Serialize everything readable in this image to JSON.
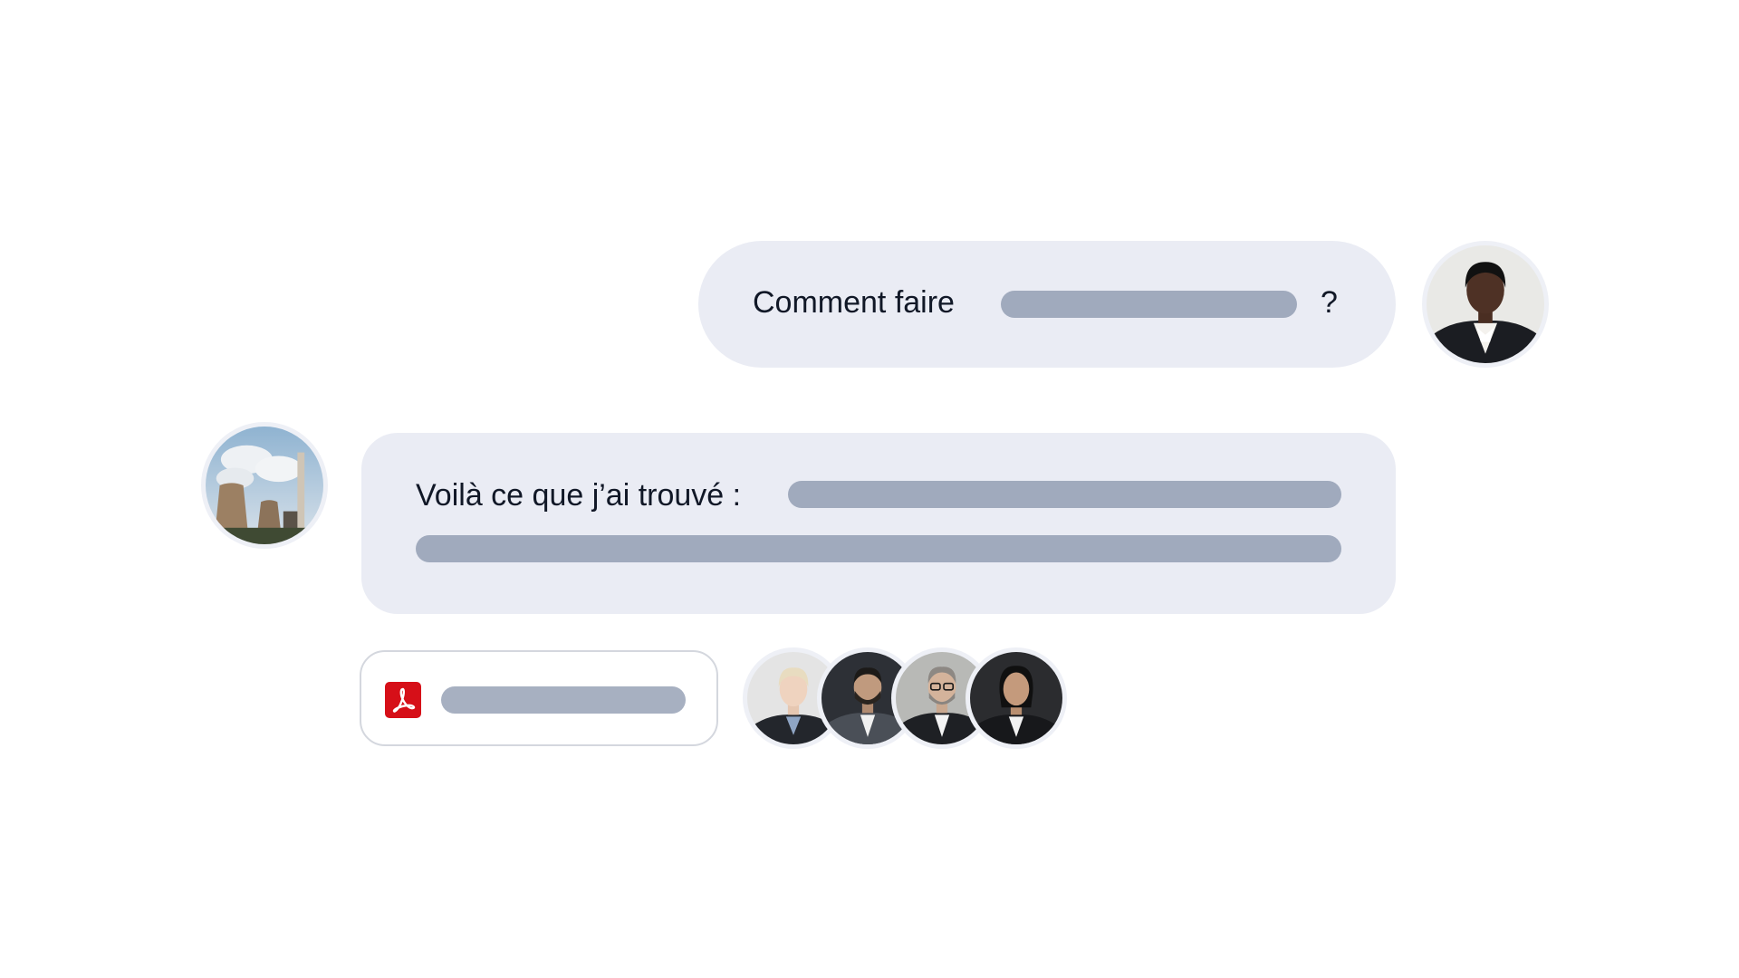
{
  "conversation": {
    "user_message": {
      "prefix": "Comment faire",
      "suffix": "?",
      "avatar_icon": "professional-woman-portrait"
    },
    "assistant_message": {
      "text": "Voilà ce que j’ai trouvé :",
      "avatar_icon": "power-plant-cooling-towers-photo"
    },
    "attachment": {
      "icon": "pdf-icon",
      "icon_color": "#d60f18"
    },
    "contributors": [
      {
        "icon": "contributor-avatar-blond-woman"
      },
      {
        "icon": "contributor-avatar-bearded-man"
      },
      {
        "icon": "contributor-avatar-man-with-glasses"
      },
      {
        "icon": "contributor-avatar-woman-dark-hair"
      }
    ]
  },
  "colors": {
    "bubble": "#eaecf4",
    "placeholder_pill": "#a0aabd",
    "text": "#111827"
  }
}
